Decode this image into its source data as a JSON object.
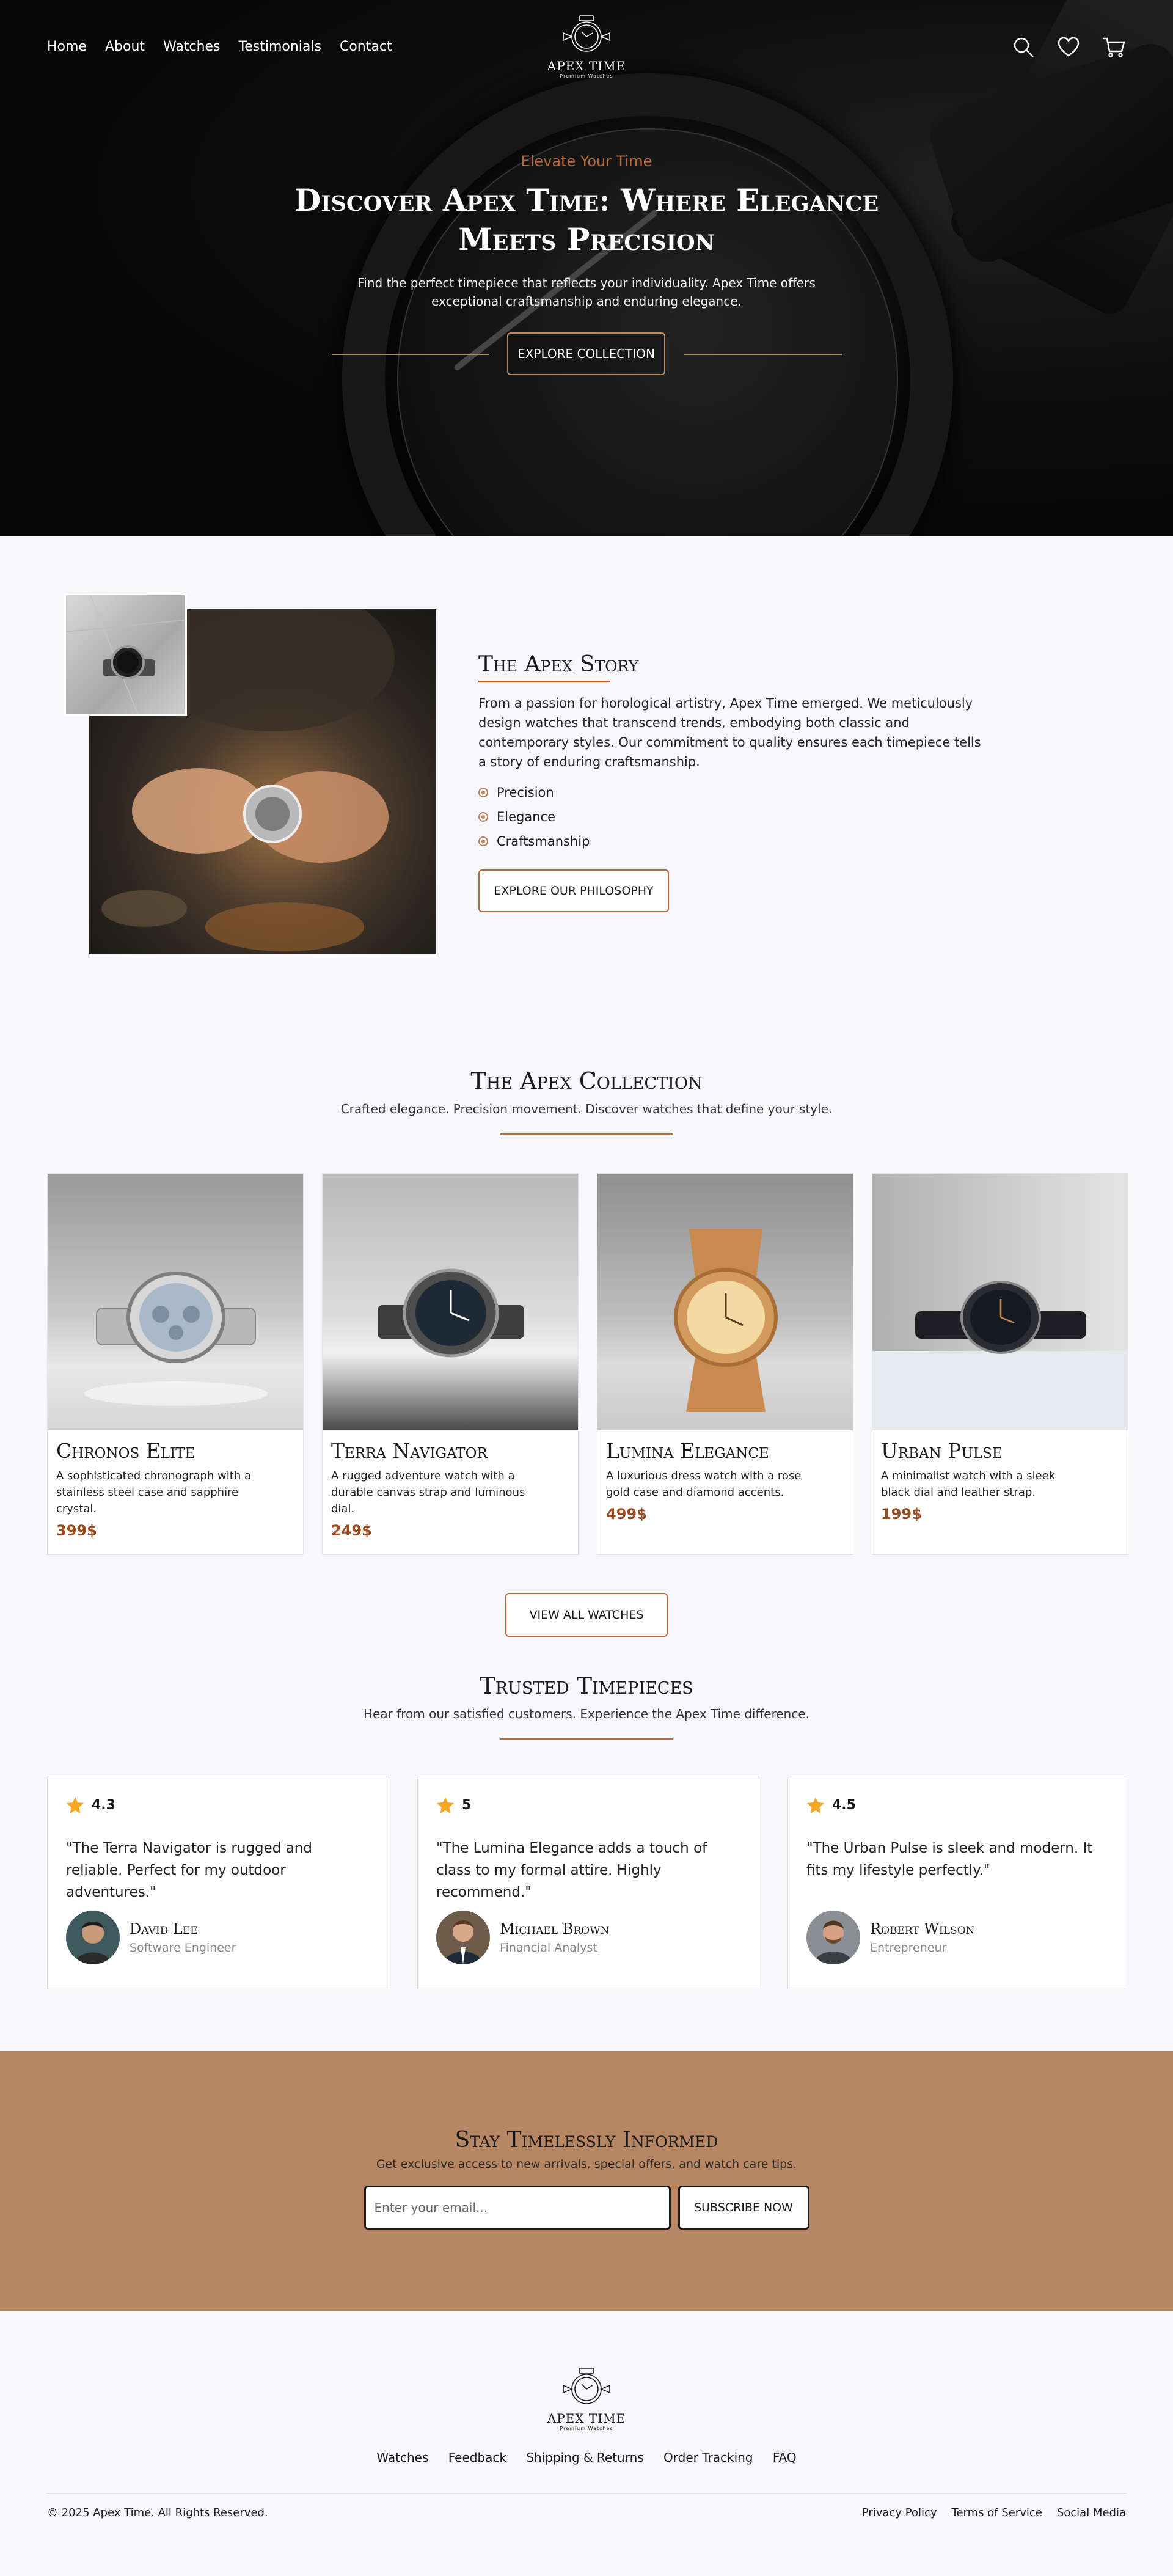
{
  "nav": {
    "links": [
      "Home",
      "About",
      "Watches",
      "Testimonials",
      "Contact"
    ],
    "logo_brand": "APEX TIME",
    "logo_tag": "Premium Watches",
    "icons": [
      "search-icon",
      "heart-icon",
      "cart-icon"
    ]
  },
  "hero": {
    "eyebrow": "Elevate Your Time",
    "title_line1": "Discover Apex Time: Where Elegance",
    "title_line2": "Meets Precision",
    "subtitle_line1": "Find the perfect timepiece that reflects your individuality. Apex Time offers",
    "subtitle_line2": "exceptional craftsmanship and enduring elegance.",
    "cta": "EXPLORE COLLECTION"
  },
  "story": {
    "title": "The Apex Story",
    "body": "From a passion for horological artistry, Apex Time emerged. We meticulously design watches that transcend trends, embodying both classic and contemporary styles. Our commitment to quality ensures each timepiece tells a story of enduring craftsmanship.",
    "values": [
      "Precision",
      "Elegance",
      "Craftsmanship"
    ],
    "cta": "EXPLORE OUR PHILOSOPHY"
  },
  "collection": {
    "title": "The Apex Collection",
    "subtitle": "Crafted elegance. Precision movement. Discover watches that define your style.",
    "products": [
      {
        "name": "Chronos Elite",
        "desc": "A sophisticated chronograph with a stainless steel case and sapphire crystal.",
        "price": "399$"
      },
      {
        "name": "Terra Navigator",
        "desc": "A rugged adventure watch with a durable canvas strap and luminous dial.",
        "price": "249$"
      },
      {
        "name": "Lumina Elegance",
        "desc": "A luxurious dress watch with a rose gold case and diamond accents.",
        "price": "499$"
      },
      {
        "name": "Urban Pulse",
        "desc": "A minimalist watch with a sleek black dial and leather strap.",
        "price": "199$"
      }
    ],
    "cta": "VIEW ALL WATCHES"
  },
  "testimonials": {
    "title": "Trusted Timepieces",
    "subtitle": "Hear from our satisfied customers. Experience the Apex Time difference.",
    "reviews": [
      {
        "rating": "4.3",
        "quote": "\"The Terra Navigator is rugged and reliable. Perfect for my outdoor adventures.\"",
        "name": "David Lee",
        "role": "Software Engineer"
      },
      {
        "rating": "5",
        "quote": "\"The Lumina Elegance adds a touch of class to my formal attire. Highly recommend.\"",
        "name": "Michael Brown",
        "role": "Financial Analyst"
      },
      {
        "rating": "4.5",
        "quote": "\"The Urban Pulse is sleek and modern. It fits my lifestyle perfectly.\"",
        "name": "Robert Wilson",
        "role": "Entrepreneur"
      }
    ]
  },
  "newsletter": {
    "title": "Stay Timelessly Informed",
    "subtitle": "Get exclusive access to new arrivals, special offers, and watch care tips.",
    "placeholder": "Enter your email...",
    "button": "SUBSCRIBE NOW"
  },
  "footer": {
    "logo_brand": "APEX TIME",
    "logo_tag": "Premium Watches",
    "links": [
      "Watches",
      "Feedback",
      "Shipping & Returns",
      "Order Tracking",
      "FAQ"
    ],
    "copyright": "© 2025 Apex Time. All Rights Reserved.",
    "legal": [
      "Privacy Policy",
      "Terms of Service",
      "Social Media"
    ]
  },
  "colors": {
    "accent": "#b56a3c",
    "price": "#9a4a1e",
    "newsletter_bg": "#b68762",
    "page_bg": "#f7f7fc",
    "star": "#f5a623"
  }
}
